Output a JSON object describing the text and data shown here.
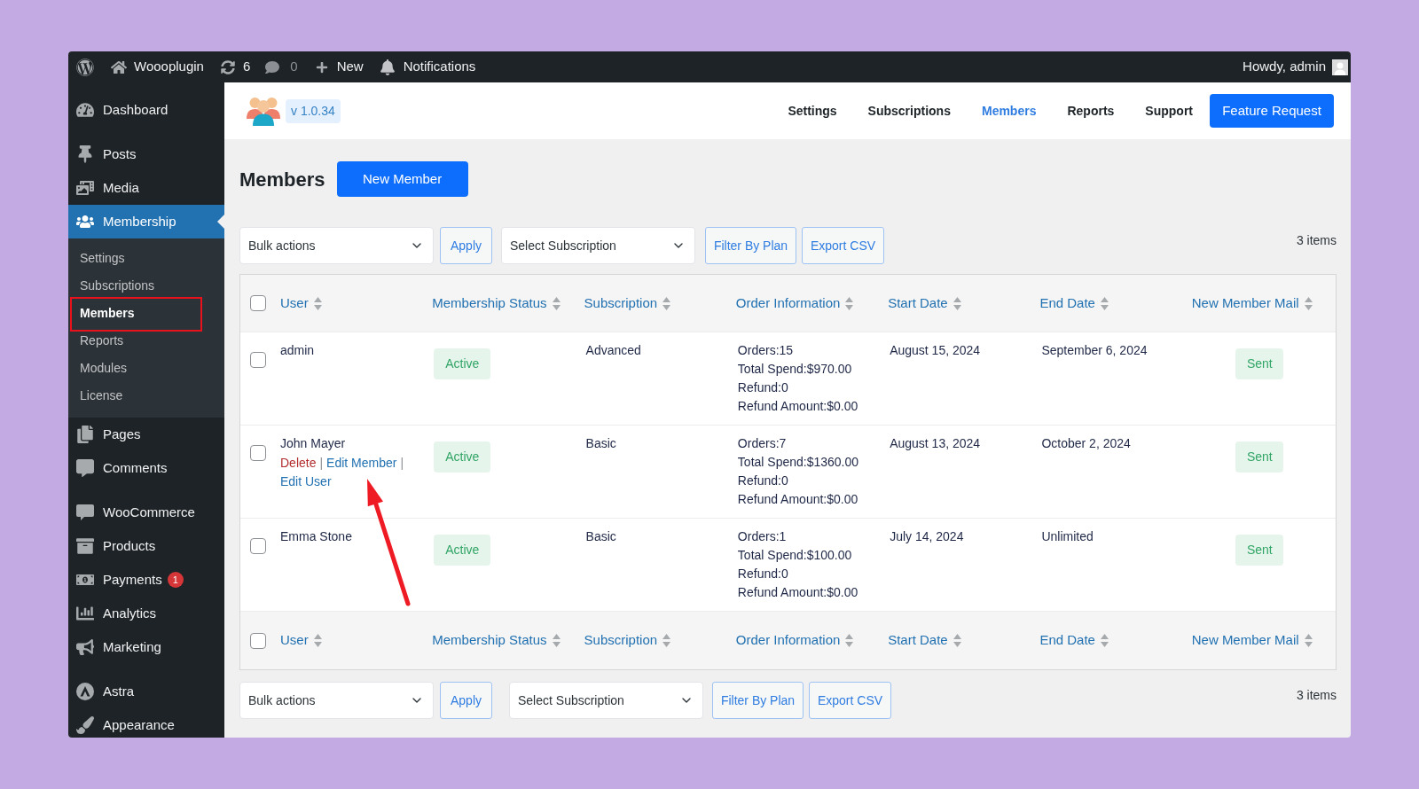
{
  "admin_bar": {
    "site_name": "Woooplugin",
    "updates_count": "6",
    "comments_count": "0",
    "new_label": "New",
    "notifications_label": "Notifications",
    "greeting": "Howdy, admin"
  },
  "sidebar": {
    "sections": [
      {
        "items": [
          {
            "label": "Dashboard",
            "selected": false
          }
        ]
      },
      {
        "items": [
          {
            "label": "Posts",
            "selected": false
          },
          {
            "label": "Media",
            "selected": false
          },
          {
            "label": "Membership",
            "selected": true,
            "children": [
              {
                "label": "Settings",
                "selected": false,
                "annotated": false
              },
              {
                "label": "Subscriptions",
                "selected": false,
                "annotated": false
              },
              {
                "label": "Members",
                "selected": true,
                "annotated": true
              },
              {
                "label": "Reports",
                "selected": false,
                "annotated": false
              },
              {
                "label": "Modules",
                "selected": false,
                "annotated": false
              },
              {
                "label": "License",
                "selected": false,
                "annotated": false
              }
            ]
          },
          {
            "label": "Pages",
            "selected": false
          },
          {
            "label": "Comments",
            "selected": false
          }
        ]
      },
      {
        "items": [
          {
            "label": "WooCommerce",
            "selected": false
          },
          {
            "label": "Products",
            "selected": false
          },
          {
            "label": "Payments",
            "selected": false,
            "badge": "1"
          },
          {
            "label": "Analytics",
            "selected": false
          },
          {
            "label": "Marketing",
            "selected": false
          }
        ]
      },
      {
        "items": [
          {
            "label": "Astra",
            "selected": false
          },
          {
            "label": "Appearance",
            "selected": false
          }
        ]
      }
    ]
  },
  "plugin_header": {
    "version": "v 1.0.34",
    "nav": [
      {
        "label": "Settings",
        "selected": false
      },
      {
        "label": "Subscriptions",
        "selected": false
      },
      {
        "label": "Members",
        "selected": true
      },
      {
        "label": "Reports",
        "selected": false
      },
      {
        "label": "Support",
        "selected": false
      }
    ],
    "feature_button": "Feature Request"
  },
  "page": {
    "title": "Members",
    "new_button": "New Member"
  },
  "top_toolbar": {
    "bulk_action": "Bulk actions",
    "apply": "Apply",
    "subscription_filter": "Select Subscription",
    "filter_button": "Filter By Plan",
    "export_button": "Export CSV",
    "count": "3 items"
  },
  "table": {
    "header_checkbox": {
      "checked": false
    },
    "columns": [
      "User",
      "Membership Status",
      "Subscription",
      "Order Information",
      "Start Date",
      "End Date",
      "New Member Mail"
    ],
    "rows": [
      {
        "checked": false,
        "user": "admin",
        "status": "Active",
        "subscription": "Advanced",
        "order_info": [
          "Orders:15",
          "Total Spend:$970.00",
          "Refund:0",
          "Refund Amount:$0.00"
        ],
        "start_date": "August 15, 2024",
        "end_date": "September 6, 2024",
        "mail_status": "Sent"
      },
      {
        "checked": false,
        "user": "John Mayer",
        "actions": [
          {
            "label": "Delete",
            "kind": "danger",
            "separator": "|",
            "annotated": false
          },
          {
            "label": "Edit Member",
            "kind": "link",
            "separator": "|",
            "annotated": true
          },
          {
            "label": "Edit User",
            "kind": "link",
            "annotated": false
          }
        ],
        "status": "Active",
        "subscription": "Basic",
        "order_info": [
          "Orders:7",
          "Total Spend:$1360.00",
          "Refund:0",
          "Refund Amount:$0.00"
        ],
        "start_date": "August 13, 2024",
        "end_date": "October 2, 2024",
        "mail_status": "Sent"
      },
      {
        "checked": false,
        "user": "Emma Stone",
        "status": "Active",
        "subscription": "Basic",
        "order_info": [
          "Orders:1",
          "Total Spend:$100.00",
          "Refund:0",
          "Refund Amount:$0.00"
        ],
        "start_date": "July 14, 2024",
        "end_date": "Unlimited",
        "mail_status": "Sent"
      }
    ],
    "footer_checkbox": {
      "checked": false
    },
    "footer_columns": [
      "User",
      "Membership Status",
      "Subscription",
      "Order Information",
      "Start Date",
      "End Date",
      "New Member Mail"
    ]
  },
  "bottom_toolbar": {
    "bulk_action": "Bulk actions",
    "apply": "Apply",
    "subscription_filter": "Select Subscription",
    "filter_button": "Filter By Plan",
    "export_button": "Export CSV",
    "count": "3 items"
  }
}
